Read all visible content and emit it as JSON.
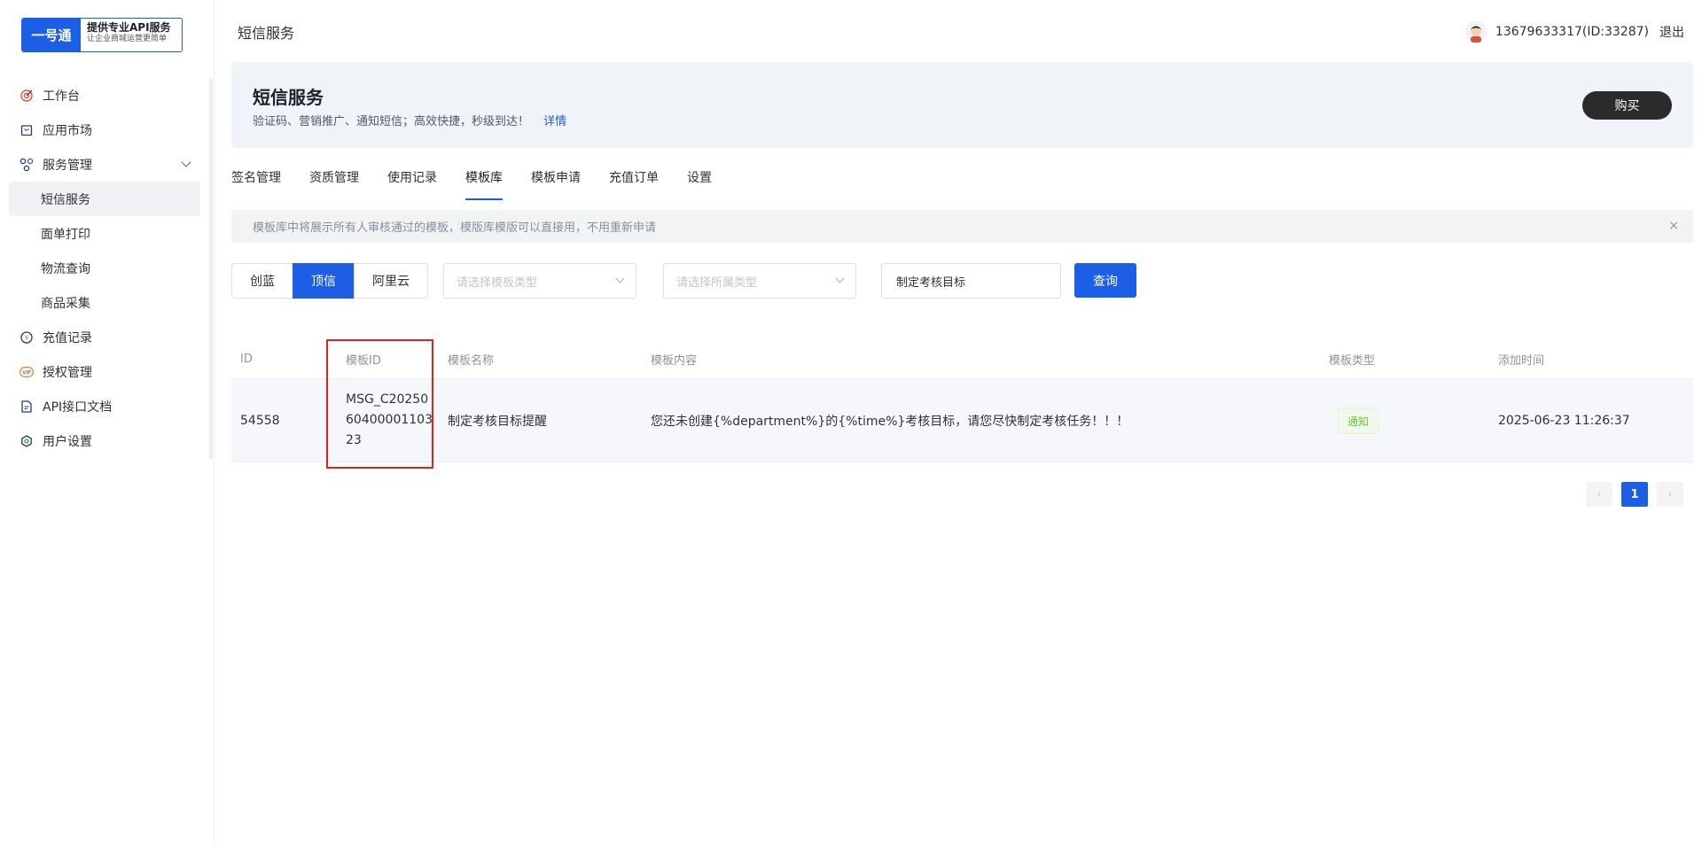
{
  "logo": {
    "main": "一号通",
    "line1": "提供专业API服务",
    "line2": "让企业商城运营更简单"
  },
  "sidebar": {
    "items": [
      {
        "label": "工作台",
        "icon": "target-icon"
      },
      {
        "label": "应用市场",
        "icon": "bag-icon"
      },
      {
        "label": "服务管理",
        "icon": "cluster-icon"
      },
      {
        "label": "短信服务"
      },
      {
        "label": "面单打印"
      },
      {
        "label": "物流查询"
      },
      {
        "label": "商品采集"
      },
      {
        "label": "充值记录",
        "icon": "coin-icon"
      },
      {
        "label": "授权管理",
        "icon": "vip-icon"
      },
      {
        "label": "API接口文档",
        "icon": "doc-icon"
      },
      {
        "label": "用户设置",
        "icon": "settings-icon"
      }
    ]
  },
  "header": {
    "title": "短信服务",
    "user": "13679633317(ID:33287)",
    "logout": "退出"
  },
  "banner": {
    "title": "短信服务",
    "desc": "验证码、营销推广、通知短信；高效快捷，秒级到达！",
    "link": "详情",
    "buy": "购买"
  },
  "tabs": [
    "签名管理",
    "资质管理",
    "使用记录",
    "模板库",
    "模板申请",
    "充值订单",
    "设置"
  ],
  "notice": {
    "text": "模板库中将展示所有人审核通过的模板，模版库模版可以直接用，不用重新申请",
    "close": "×"
  },
  "filters": {
    "providers": [
      "创蓝",
      "顶信",
      "阿里云"
    ],
    "template_type_placeholder": "请选择模板类型",
    "owner_type_placeholder": "请选择所属类型",
    "keyword": "制定考核目标",
    "query": "查询"
  },
  "table": {
    "headers": [
      "ID",
      "模板ID",
      "模板名称",
      "模板内容",
      "模板类型",
      "添加时间"
    ],
    "rows": [
      {
        "id": "54558",
        "template_id": [
          "MSG_C20250",
          "60400001103",
          "23"
        ],
        "name": "制定考核目标提醒",
        "content": "您还未创建{%department%}的{%time%}考核目标，请您尽快制定考核任务！！！",
        "type": "通知",
        "time": "2025-06-23 11:26:37"
      }
    ]
  },
  "pagination": {
    "prev": "‹",
    "current": "1",
    "next": "›"
  },
  "colors": {
    "primary": "#1c5fe6",
    "highlight": "#e0241b",
    "tag_green": "#67c23a"
  }
}
